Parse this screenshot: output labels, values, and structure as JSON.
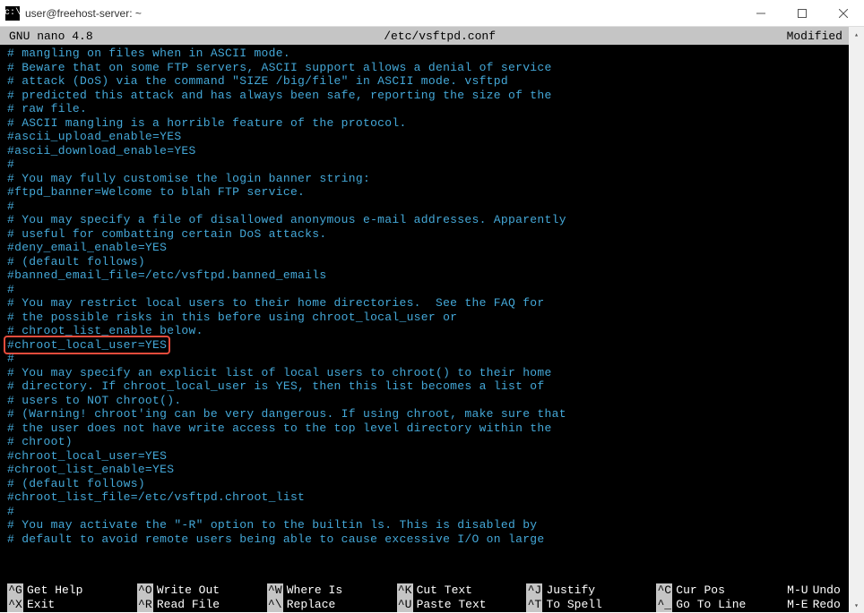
{
  "window": {
    "title": "user@freehost-server: ~",
    "icon_char": "c:\\"
  },
  "nano": {
    "header_left": "  GNU nano 4.8",
    "header_center": "/etc/vsftpd.conf",
    "header_right": "Modified"
  },
  "lines": [
    "# mangling on files when in ASCII mode.",
    "# Beware that on some FTP servers, ASCII support allows a denial of service",
    "# attack (DoS) via the command \"SIZE /big/file\" in ASCII mode. vsftpd",
    "# predicted this attack and has always been safe, reporting the size of the",
    "# raw file.",
    "# ASCII mangling is a horrible feature of the protocol.",
    "#ascii_upload_enable=YES",
    "#ascii_download_enable=YES",
    "#",
    "# You may fully customise the login banner string:",
    "#ftpd_banner=Welcome to blah FTP service.",
    "#",
    "# You may specify a file of disallowed anonymous e-mail addresses. Apparently",
    "# useful for combatting certain DoS attacks.",
    "#deny_email_enable=YES",
    "# (default follows)",
    "#banned_email_file=/etc/vsftpd.banned_emails",
    "#",
    "# You may restrict local users to their home directories.  See the FAQ for",
    "# the possible risks in this before using chroot_local_user or",
    "# chroot_list_enable below."
  ],
  "highlighted_line": "#chroot_local_user=YES",
  "lines_after": [
    "#",
    "# You may specify an explicit list of local users to chroot() to their home",
    "# directory. If chroot_local_user is YES, then this list becomes a list of",
    "# users to NOT chroot().",
    "# (Warning! chroot'ing can be very dangerous. If using chroot, make sure that",
    "# the user does not have write access to the top level directory within the",
    "# chroot)",
    "#chroot_local_user=YES",
    "#chroot_list_enable=YES",
    "# (default follows)",
    "#chroot_list_file=/etc/vsftpd.chroot_list",
    "#",
    "# You may activate the \"-R\" option to the builtin ls. This is disabled by",
    "# default to avoid remote users being able to cause excessive I/O on large"
  ],
  "shortcuts": {
    "row1": [
      {
        "key": "^G",
        "label": "Get Help"
      },
      {
        "key": "^O",
        "label": "Write Out"
      },
      {
        "key": "^W",
        "label": "Where Is"
      },
      {
        "key": "^K",
        "label": "Cut Text"
      },
      {
        "key": "^J",
        "label": "Justify"
      },
      {
        "key": "^C",
        "label": "Cur Pos"
      },
      {
        "key": "M-U",
        "label": "Undo"
      }
    ],
    "row2": [
      {
        "key": "^X",
        "label": "Exit"
      },
      {
        "key": "^R",
        "label": "Read File"
      },
      {
        "key": "^\\",
        "label": "Replace"
      },
      {
        "key": "^U",
        "label": "Paste Text"
      },
      {
        "key": "^T",
        "label": "To Spell"
      },
      {
        "key": "^_",
        "label": "Go To Line"
      },
      {
        "key": "M-E",
        "label": "Redo"
      }
    ]
  }
}
